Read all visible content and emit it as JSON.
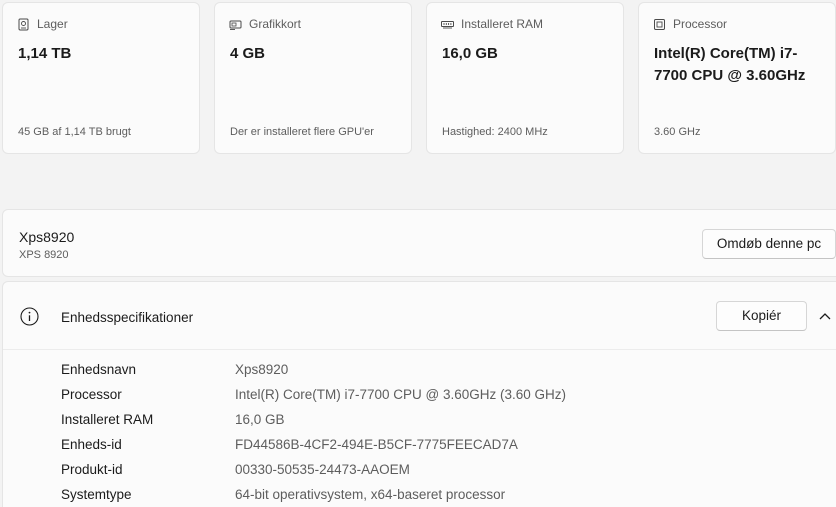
{
  "cards": [
    {
      "icon": "storage-icon",
      "label": "Lager",
      "value": "1,14 TB",
      "sub": "45 GB af 1,14 TB brugt"
    },
    {
      "icon": "graphics-card-icon",
      "label": "Grafikkort",
      "value": "4 GB",
      "sub": "Der er installeret flere GPU'er"
    },
    {
      "icon": "ram-icon",
      "label": "Installeret RAM",
      "value": "16,0 GB",
      "sub": "Hastighed: 2400 MHz"
    },
    {
      "icon": "processor-icon",
      "label": "Processor",
      "value": "Intel(R) Core(TM) i7-7700 CPU @ 3.60GHz",
      "sub": "3.60 GHz"
    }
  ],
  "pc": {
    "name": "Xps8920",
    "model": "XPS 8920",
    "rename_label": "Omdøb denne pc"
  },
  "specs": {
    "title": "Enhedsspecifikationer",
    "copy_label": "Kopiér",
    "rows": [
      {
        "key": "Enhedsnavn",
        "value": "Xps8920"
      },
      {
        "key": "Processor",
        "value": "Intel(R) Core(TM) i7-7700 CPU @ 3.60GHz (3.60 GHz)"
      },
      {
        "key": "Installeret RAM",
        "value": "16,0 GB"
      },
      {
        "key": "Enheds-id",
        "value": "FD44586B-4CF2-494E-B5CF-7775FEECAD7A"
      },
      {
        "key": "Produkt-id",
        "value": "00330-50535-24473-AAOEM"
      },
      {
        "key": "Systemtype",
        "value": "64-bit operativsystem, x64-baseret processor"
      }
    ]
  }
}
